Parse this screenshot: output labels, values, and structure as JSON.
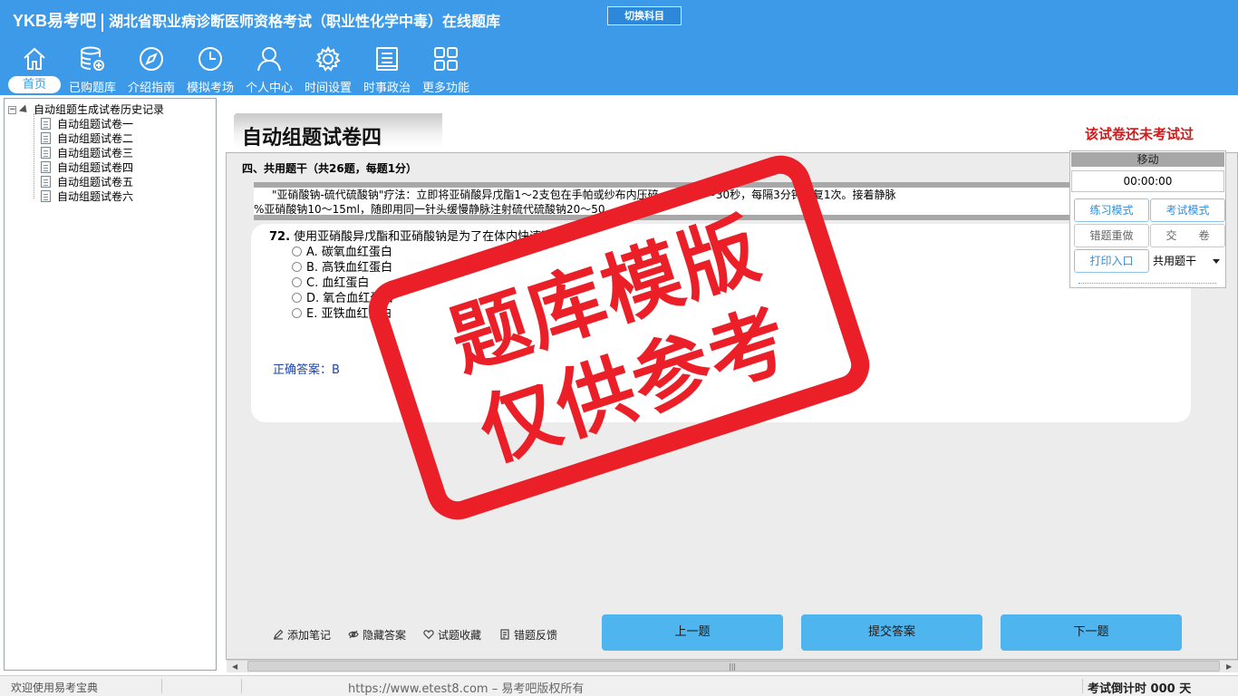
{
  "header": {
    "logo": "YKB易考吧",
    "title": "湖北省职业病诊断医师资格考试（职业性化学中毒）在线题库",
    "switch_label": "切换科目"
  },
  "nav": {
    "items": [
      {
        "label": "首页",
        "icon": "home-icon"
      },
      {
        "label": "已购题库",
        "icon": "database-icon"
      },
      {
        "label": "介绍指南",
        "icon": "compass-icon"
      },
      {
        "label": "模拟考场",
        "icon": "clock-icon"
      },
      {
        "label": "个人中心",
        "icon": "user-icon"
      },
      {
        "label": "时间设置",
        "icon": "gear-icon"
      },
      {
        "label": "时事政治",
        "icon": "news-icon"
      },
      {
        "label": "更多功能",
        "icon": "grid-icon"
      }
    ]
  },
  "tree": {
    "root": "自动组题生成试卷历史记录",
    "items": [
      "自动组题试卷一",
      "自动组题试卷二",
      "自动组题试卷三",
      "自动组题试卷四",
      "自动组题试卷五",
      "自动组题试卷六"
    ]
  },
  "paper": {
    "title": "自动组题试卷四",
    "status": "该试卷还未考试过",
    "section_heading": "四、共用题干（共26题，每题1分）",
    "stem_line1": "\"亚硝酸钠-硫代硫酸钠\"疗法：立即将亚硝酸异戊酯1～2支包在手帕或纱布内压碎，吸入15～30秒，每隔3分钟重复1次。接着静脉",
    "stem_line2": "%亚硝酸钠10～15ml，随即用同一针头缓慢静脉注射硫代硫酸钠20～50",
    "question_number": "72.",
    "question_text": "使用亚硝酸异戊酯和亚硝酸钠是为了在体内快速形成",
    "options": [
      "A. 碳氧血红蛋白",
      "B. 高铁血红蛋白",
      "C. 血红蛋白",
      "D. 氧合血红蛋白",
      "E. 亚铁血红蛋白"
    ],
    "answer": "正确答案：B"
  },
  "control": {
    "move": "移动",
    "timer": "00:00:00",
    "practice_mode": "练习模式",
    "exam_mode": "考试模式",
    "redo_wrong": "错题重做",
    "submit_paper": "交　　卷",
    "print_entry": "打印入口",
    "type_select": "共用题干"
  },
  "stamp": {
    "line1": "题库模版",
    "line2": "仅供参考"
  },
  "toolbar": {
    "add_note": "添加笔记",
    "hide_answer": "隐藏答案",
    "favorite": "试题收藏",
    "feedback": "错题反馈",
    "prev": "上一题",
    "submit_answer": "提交答案",
    "next": "下一题"
  },
  "status": {
    "welcome": "欢迎使用易考宝典",
    "url": "https://www.etest8.com – 易考吧版权所有",
    "countdown": "考试倒计时 000 天"
  },
  "colors": {
    "header_bg": "#3d9ae8",
    "stamp_red": "#ea1f27",
    "button_blue": "#4fb5ee",
    "status_red": "#d01a1a",
    "answer_blue": "#1d43b0"
  }
}
